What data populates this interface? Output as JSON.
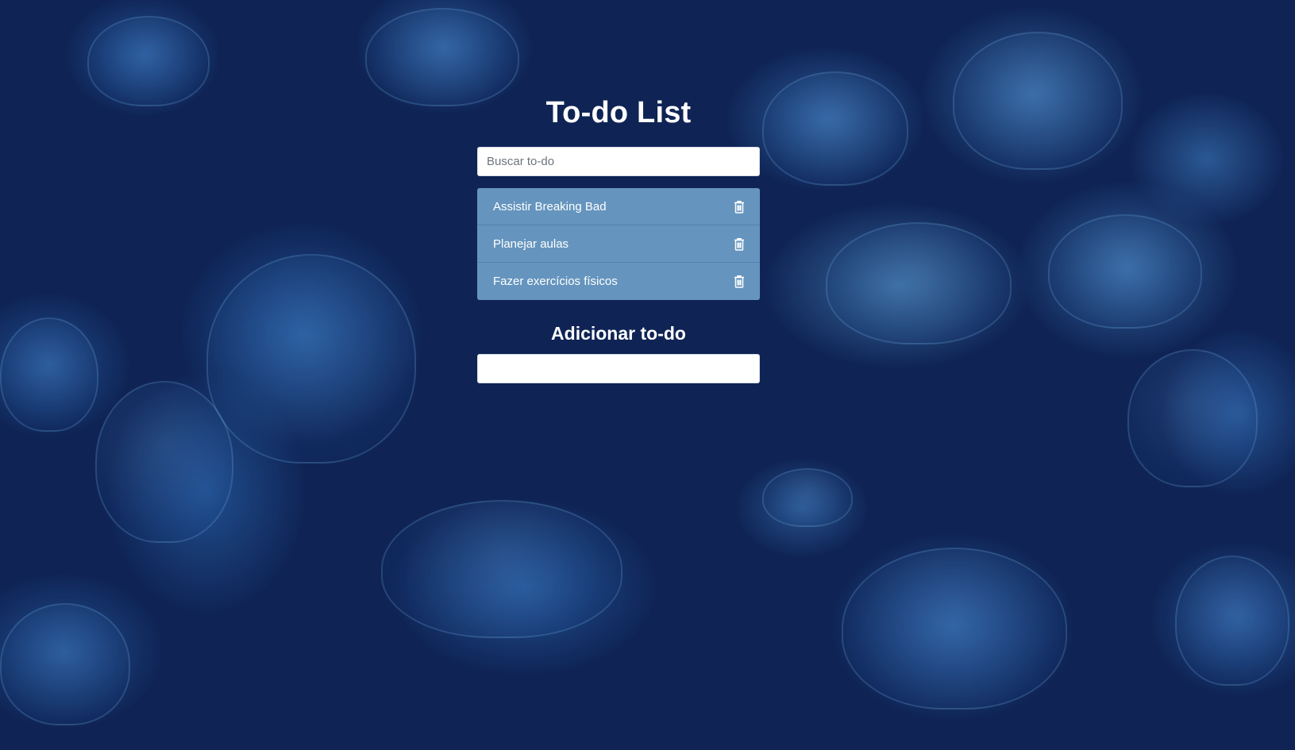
{
  "header": {
    "title": "To-do List"
  },
  "search": {
    "placeholder": "Buscar to-do"
  },
  "todos": [
    {
      "text": "Assistir Breaking Bad",
      "icon": "trash-icon"
    },
    {
      "text": "Planejar aulas",
      "icon": "trash-icon"
    },
    {
      "text": "Fazer exercícios físicos",
      "icon": "trash-icon"
    }
  ],
  "add": {
    "title": "Adicionar to-do",
    "value": ""
  },
  "colors": {
    "background": "#0f2455",
    "list_item": "#6ca0c8",
    "text": "#ffffff"
  }
}
